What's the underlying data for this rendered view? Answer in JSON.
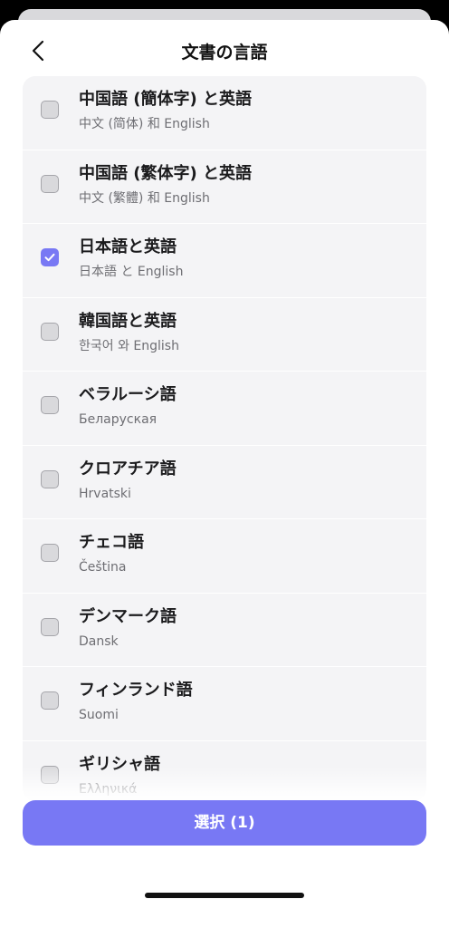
{
  "header": {
    "title": "文書の言語",
    "back_icon": "chevron-left-icon"
  },
  "languages": [
    {
      "title": "中国語 (簡体字) と英語",
      "subtitle": "中文 (简体) 和 English",
      "checked": false
    },
    {
      "title": "中国語 (繁体字) と英語",
      "subtitle": "中文 (繁體) 和 English",
      "checked": false
    },
    {
      "title": "日本語と英語",
      "subtitle": "日本語 と English",
      "checked": true
    },
    {
      "title": "韓国語と英語",
      "subtitle": "한국어 와 English",
      "checked": false
    },
    {
      "title": "ベラルーシ語",
      "subtitle": "Беларуская",
      "checked": false
    },
    {
      "title": "クロアチア語",
      "subtitle": "Hrvatski",
      "checked": false
    },
    {
      "title": "チェコ語",
      "subtitle": "Čeština",
      "checked": false
    },
    {
      "title": "デンマーク語",
      "subtitle": "Dansk",
      "checked": false
    },
    {
      "title": "フィンランド語",
      "subtitle": "Suomi",
      "checked": false
    },
    {
      "title": "ギリシャ語",
      "subtitle": "Ελληνικά",
      "checked": false
    }
  ],
  "footer": {
    "select_label": "選択 (1)"
  },
  "colors": {
    "accent": "#7878f4",
    "list_bg": "#f4f4f6",
    "checkbox_unchecked": "#d9d9dc"
  }
}
